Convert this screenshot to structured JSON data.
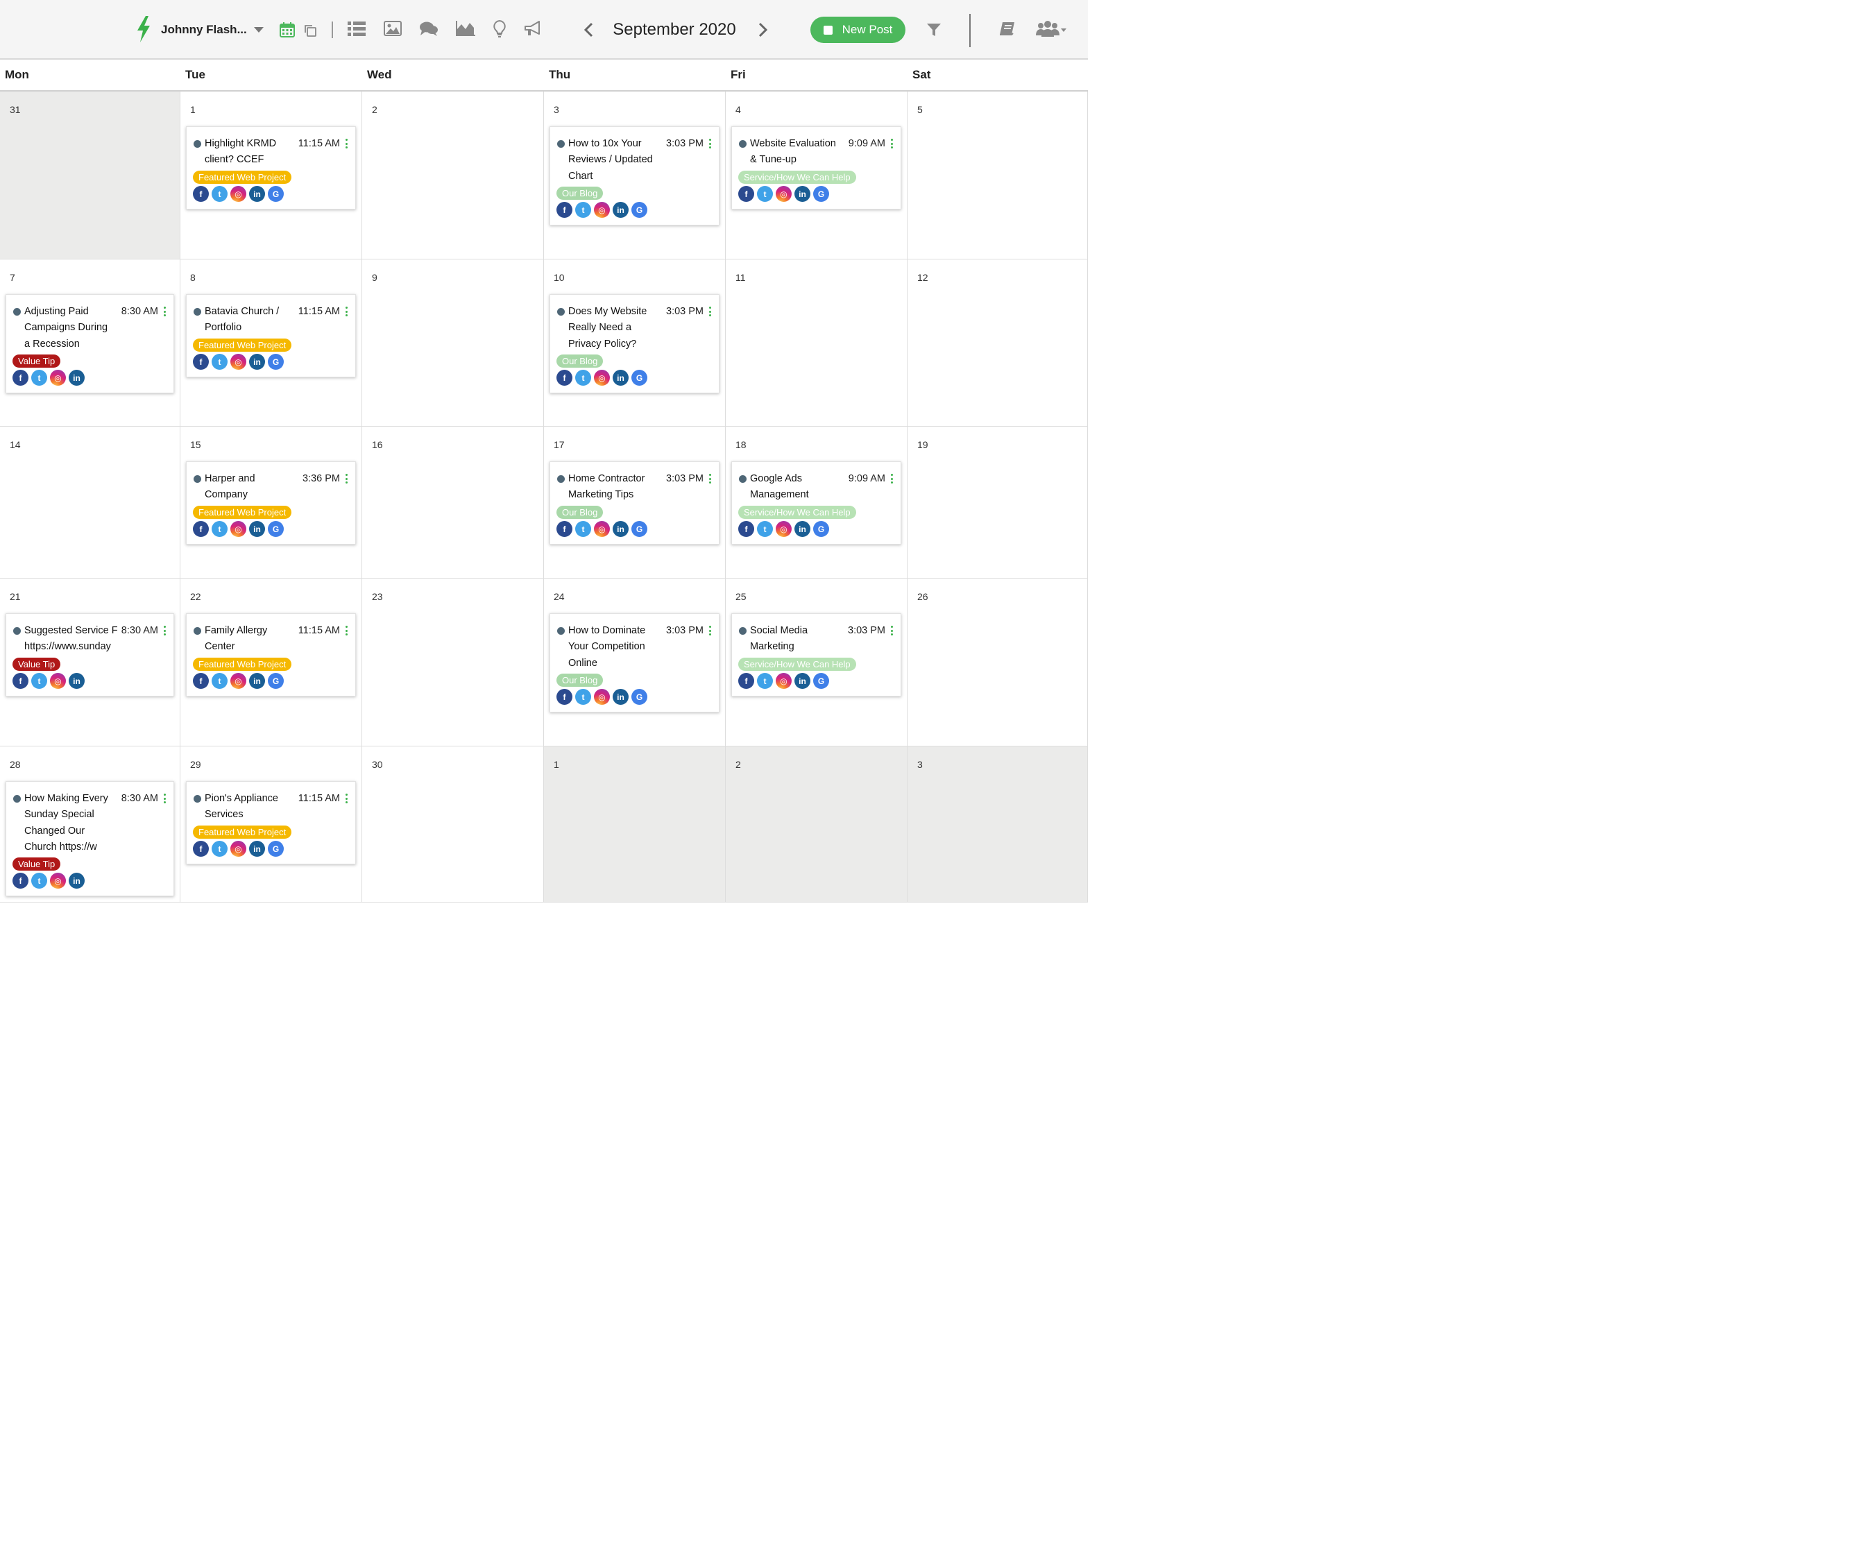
{
  "header": {
    "account_name": "Johnny Flash...",
    "month_label": "September 2020",
    "new_post_label": "New Post"
  },
  "weekdays": [
    "Mon",
    "Tue",
    "Wed",
    "Thu",
    "Fri",
    "Sat"
  ],
  "weeks": [
    {
      "days": [
        {
          "num": "31",
          "posts": []
        },
        {
          "num": "1",
          "posts": [
            {
              "title_lines": [
                "Highlight KRMD",
                "client? CCEF"
              ],
              "time": "11:15 AM",
              "tag": "Featured Web Project",
              "tag_type": "featured",
              "networks": [
                "facebook",
                "twitter",
                "instagram",
                "linkedin",
                "google"
              ]
            }
          ]
        },
        {
          "num": "2",
          "posts": []
        },
        {
          "num": "3",
          "posts": [
            {
              "title_lines": [
                "How to 10x Your",
                "Reviews / Updated",
                "Chart"
              ],
              "time": "3:03 PM",
              "tag": "Our Blog",
              "tag_type": "blog",
              "networks": [
                "facebook",
                "twitter",
                "instagram",
                "linkedin",
                "google"
              ]
            }
          ]
        },
        {
          "num": "4",
          "posts": [
            {
              "title_lines": [
                "Website Evaluation",
                "& Tune-up"
              ],
              "time": "9:09 AM",
              "tag": "Service/How We Can Help",
              "tag_type": "service",
              "networks": [
                "facebook",
                "twitter",
                "instagram",
                "linkedin",
                "google"
              ]
            }
          ]
        },
        {
          "num": "5",
          "posts": []
        }
      ]
    },
    {
      "days": [
        {
          "num": "7",
          "posts": [
            {
              "title_lines": [
                "Adjusting Paid",
                "Campaigns During",
                "a Recession"
              ],
              "time": "8:30 AM",
              "tag": "Value Tip",
              "tag_type": "value",
              "networks": [
                "facebook",
                "twitter",
                "instagram",
                "linkedin"
              ]
            }
          ]
        },
        {
          "num": "8",
          "posts": [
            {
              "title_lines": [
                "Batavia Church /",
                "Portfolio"
              ],
              "time": "11:15 AM",
              "tag": "Featured Web Project",
              "tag_type": "featured",
              "networks": [
                "facebook",
                "twitter",
                "instagram",
                "linkedin",
                "google"
              ]
            }
          ]
        },
        {
          "num": "9",
          "posts": []
        },
        {
          "num": "10",
          "posts": [
            {
              "title_lines": [
                "Does My Website",
                "Really Need a",
                "Privacy Policy?"
              ],
              "time": "3:03 PM",
              "tag": "Our Blog",
              "tag_type": "blog",
              "networks": [
                "facebook",
                "twitter",
                "instagram",
                "linkedin",
                "google"
              ]
            }
          ]
        },
        {
          "num": "11",
          "posts": []
        },
        {
          "num": "12",
          "posts": []
        }
      ]
    },
    {
      "days": [
        {
          "num": "14",
          "posts": []
        },
        {
          "num": "15",
          "posts": [
            {
              "title_lines": [
                "Harper and",
                "Company"
              ],
              "time": "3:36 PM",
              "tag": "Featured Web Project",
              "tag_type": "featured",
              "networks": [
                "facebook",
                "twitter",
                "instagram",
                "linkedin",
                "google"
              ]
            }
          ]
        },
        {
          "num": "16",
          "posts": []
        },
        {
          "num": "17",
          "posts": [
            {
              "title_lines": [
                "Home Contractor",
                "Marketing Tips"
              ],
              "time": "3:03 PM",
              "tag": "Our Blog",
              "tag_type": "blog",
              "networks": [
                "facebook",
                "twitter",
                "instagram",
                "linkedin",
                "google"
              ]
            }
          ]
        },
        {
          "num": "18",
          "posts": [
            {
              "title_lines": [
                "Google Ads",
                "Management"
              ],
              "time": "9:09 AM",
              "tag": "Service/How We Can Help",
              "tag_type": "service",
              "networks": [
                "facebook",
                "twitter",
                "instagram",
                "linkedin",
                "google"
              ]
            }
          ]
        },
        {
          "num": "19",
          "posts": []
        }
      ]
    },
    {
      "days": [
        {
          "num": "21",
          "posts": [
            {
              "title_lines": [
                "Suggested Service F",
                "https://www.sunday"
              ],
              "time": "8:30 AM",
              "tag": "Value Tip",
              "tag_type": "value",
              "networks": [
                "facebook",
                "twitter",
                "instagram",
                "linkedin"
              ]
            }
          ]
        },
        {
          "num": "22",
          "posts": [
            {
              "title_lines": [
                "Family Allergy",
                "Center"
              ],
              "time": "11:15 AM",
              "tag": "Featured Web Project",
              "tag_type": "featured",
              "networks": [
                "facebook",
                "twitter",
                "instagram",
                "linkedin",
                "google"
              ]
            }
          ]
        },
        {
          "num": "23",
          "posts": []
        },
        {
          "num": "24",
          "posts": [
            {
              "title_lines": [
                "How to Dominate",
                "Your Competition",
                "Online"
              ],
              "time": "3:03 PM",
              "tag": "Our Blog",
              "tag_type": "blog",
              "networks": [
                "facebook",
                "twitter",
                "instagram",
                "linkedin",
                "google"
              ]
            }
          ]
        },
        {
          "num": "25",
          "posts": [
            {
              "title_lines": [
                "Social Media",
                "Marketing"
              ],
              "time": "3:03 PM",
              "tag": "Service/How We Can Help",
              "tag_type": "service",
              "networks": [
                "facebook",
                "twitter",
                "instagram",
                "linkedin",
                "google"
              ]
            }
          ]
        },
        {
          "num": "26",
          "posts": []
        }
      ]
    },
    {
      "days": [
        {
          "num": "28",
          "posts": [
            {
              "title_lines": [
                "How Making Every",
                "Sunday Special",
                "Changed Our",
                "Church https://w"
              ],
              "time": "8:30 AM",
              "tag": "Value Tip",
              "tag_type": "value",
              "networks": [
                "facebook",
                "twitter",
                "instagram",
                "linkedin"
              ]
            }
          ]
        },
        {
          "num": "29",
          "posts": [
            {
              "title_lines": [
                "Pion's Appliance",
                "Services"
              ],
              "time": "11:15 AM",
              "tag": "Featured Web Project",
              "tag_type": "featured",
              "networks": [
                "facebook",
                "twitter",
                "instagram",
                "linkedin",
                "google"
              ]
            }
          ]
        },
        {
          "num": "30",
          "posts": []
        },
        {
          "num": "1",
          "posts": []
        },
        {
          "num": "2",
          "posts": []
        },
        {
          "num": "3",
          "posts": []
        }
      ]
    }
  ],
  "colors": {
    "accent_green": "#4cb85c",
    "brand_bolt": "#3bb14a",
    "featured_tag": "#f5b800",
    "blog_tag": "#a8d8a8",
    "service_tag": "#b7e2b4",
    "value_tag": "#b01818",
    "out_of_month": "#ebebea"
  }
}
